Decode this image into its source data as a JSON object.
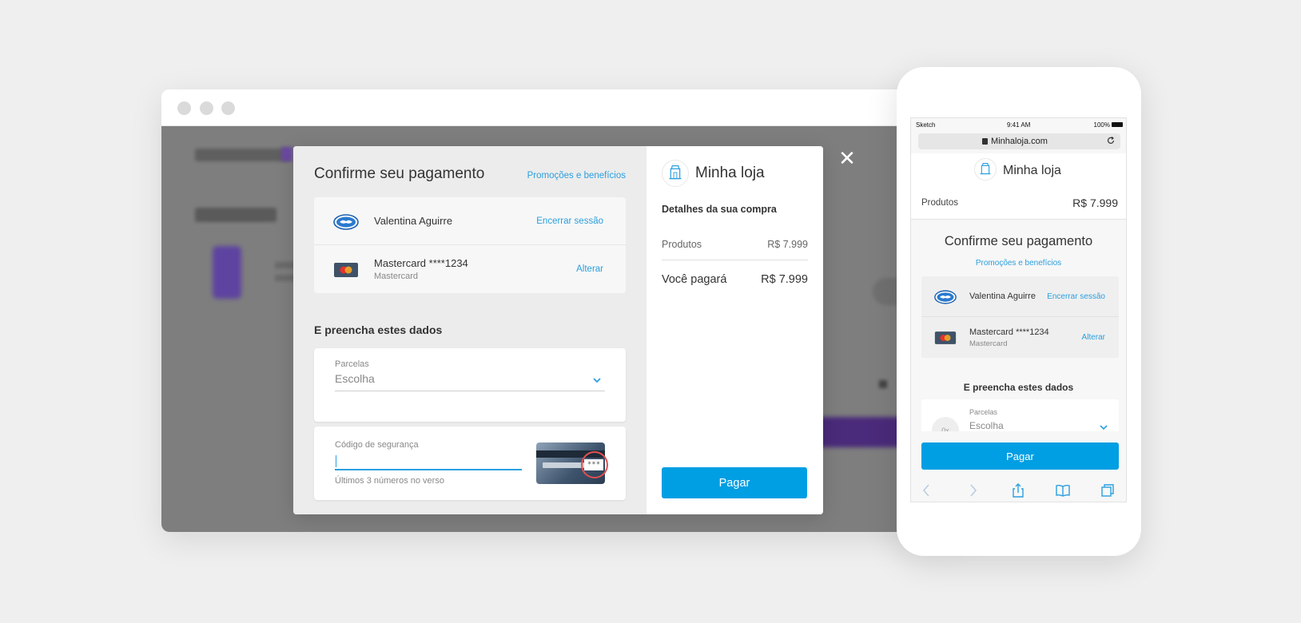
{
  "desktop": {
    "modal": {
      "title": "Confirme seu pagamento",
      "promo_link": "Promoções e benefícios",
      "account": {
        "user_name": "Valentina Aguirre",
        "logout_link": "Encerrar sessão",
        "card_name": "Mastercard ****1234",
        "card_type": "Mastercard",
        "change_link": "Alterar"
      },
      "form_title": "E preencha estes dados",
      "installments": {
        "label": "Parcelas",
        "value": "Escolha"
      },
      "security_code": {
        "label": "Código de segurança",
        "value": "",
        "help": "Últimos 3 números no verso",
        "cvv_mask": "***"
      },
      "store": {
        "name": "Minha loja",
        "details_title": "Detalhes da sua compra",
        "products_label": "Produtos",
        "products_value": "R$ 7.999",
        "total_label": "Você pagará",
        "total_value": "R$ 7.999",
        "pay_button": "Pagar"
      }
    },
    "close_label": "✕"
  },
  "mobile": {
    "status": {
      "carrier": "Sketch",
      "time": "9:41 AM",
      "battery": "100%"
    },
    "url": "Minhaloja.com",
    "store_name": "Minha loja",
    "products_label": "Produtos",
    "products_value": "R$ 7.999",
    "title": "Confirme seu pagamento",
    "promo_link": "Promoções e benefícios",
    "user_name": "Valentina Aguirre",
    "logout_link": "Encerrar sessão",
    "card_name": "Mastercard ****1234",
    "card_type": "Mastercard",
    "change_link": "Alterar",
    "form_title": "E preencha estes dados",
    "installments_label": "Parcelas",
    "installments_value": "Escolha",
    "pay_button": "Pagar"
  },
  "colors": {
    "accent": "#009ee3",
    "link": "#2b9fde",
    "overlay": "#7e7e7e"
  }
}
